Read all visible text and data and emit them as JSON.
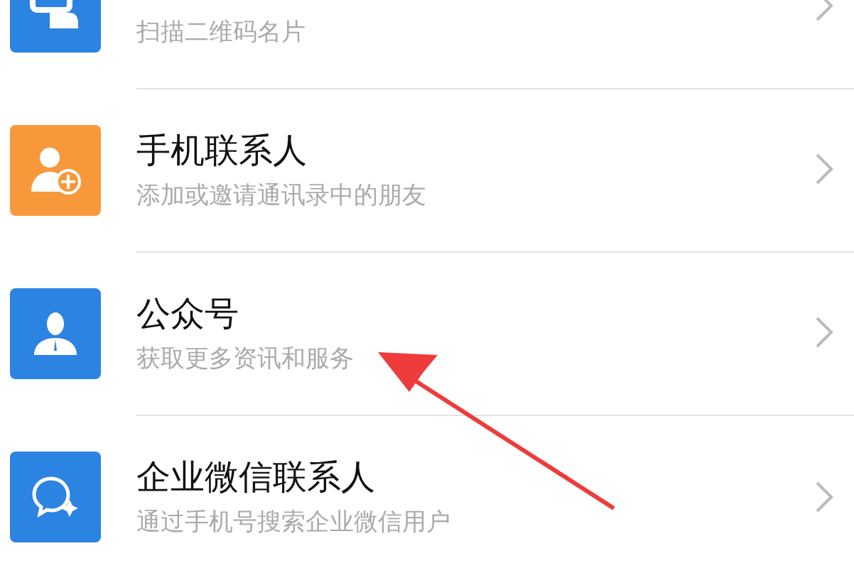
{
  "contacts_menu": [
    {
      "kind": "scan",
      "color": "#2b83e2",
      "subtitle": "扫描二维码名片"
    },
    {
      "kind": "add-contact",
      "color": "#f7993a",
      "title": "手机联系人",
      "subtitle": "添加或邀请通讯录中的朋友"
    },
    {
      "kind": "official",
      "color": "#2b83e2",
      "title": "公众号",
      "subtitle": "获取更多资讯和服务"
    },
    {
      "kind": "work",
      "color": "#2b83e2",
      "title": "企业微信联系人",
      "subtitle": "通过手机号搜索企业微信用户"
    }
  ]
}
